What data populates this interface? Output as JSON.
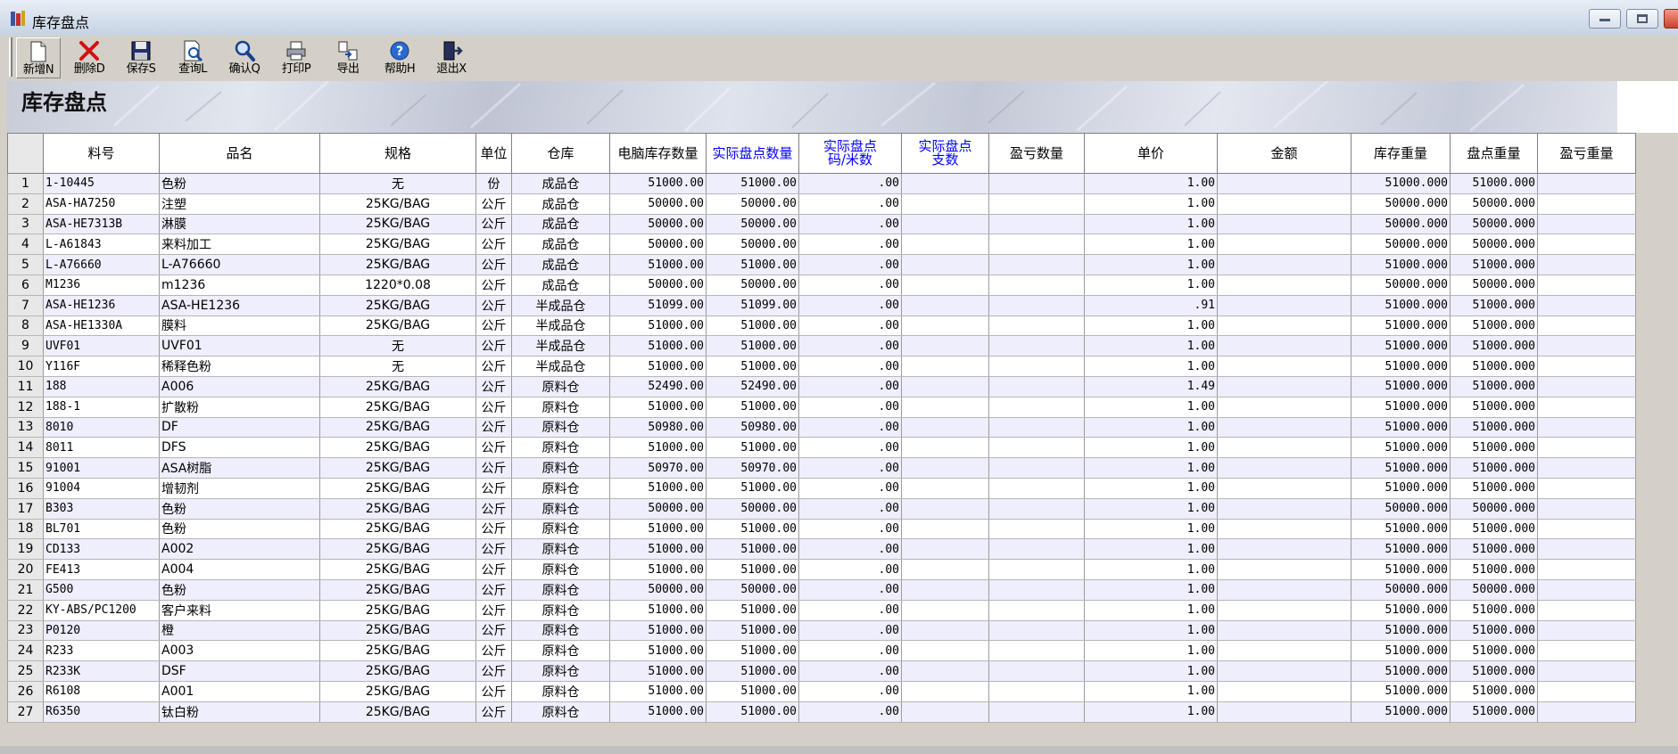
{
  "window": {
    "title": "库存盘点"
  },
  "toolbar": [
    {
      "label": "新增N",
      "icon": "new-document-icon",
      "name": "new"
    },
    {
      "label": "删除D",
      "icon": "delete-x-icon",
      "name": "delete"
    },
    {
      "label": "保存S",
      "icon": "save-disk-icon",
      "name": "save"
    },
    {
      "label": "查询L",
      "icon": "query-document-icon",
      "name": "query"
    },
    {
      "label": "确认Q",
      "icon": "magnifier-icon",
      "name": "confirm"
    },
    {
      "label": "打印P",
      "icon": "printer-icon",
      "name": "print"
    },
    {
      "label": "导出",
      "icon": "export-icon",
      "name": "export"
    },
    {
      "label": "帮助H",
      "icon": "help-icon",
      "name": "help"
    },
    {
      "label": "退出X",
      "icon": "exit-door-icon",
      "name": "exit"
    }
  ],
  "banner": {
    "title": "库存盘点"
  },
  "grid": {
    "columns": [
      {
        "key": "rownum",
        "label": "",
        "blue": false
      },
      {
        "key": "code",
        "label": "料号",
        "blue": false
      },
      {
        "key": "name",
        "label": "品名",
        "blue": false
      },
      {
        "key": "spec",
        "label": "规格",
        "blue": false
      },
      {
        "key": "unit",
        "label": "单位",
        "blue": false
      },
      {
        "key": "warehouse",
        "label": "仓库",
        "blue": false
      },
      {
        "key": "sys_qty",
        "label": "电脑库存数量",
        "blue": false
      },
      {
        "key": "act_qty",
        "label": "实际盘点数量",
        "blue": true
      },
      {
        "key": "act_code",
        "label": "实际盘点\n码/米数",
        "blue": true
      },
      {
        "key": "act_pcs",
        "label": "实际盘点\n支数",
        "blue": true
      },
      {
        "key": "diff_qty",
        "label": "盈亏数量",
        "blue": false
      },
      {
        "key": "price",
        "label": "单价",
        "blue": false
      },
      {
        "key": "amount",
        "label": "金额",
        "blue": false
      },
      {
        "key": "stock_wt",
        "label": "库存重量",
        "blue": false
      },
      {
        "key": "count_wt",
        "label": "盘点重量",
        "blue": false
      },
      {
        "key": "diff_wt",
        "label": "盈亏重量",
        "blue": false
      }
    ],
    "rows": [
      [
        "1",
        "1-10445",
        "色粉",
        "无",
        "份",
        "成品仓",
        "51000.00",
        "51000.00",
        ".00",
        "",
        "",
        "1.00",
        "",
        "51000.000",
        "51000.000",
        ""
      ],
      [
        "2",
        "ASA-HA7250",
        "注塑",
        "25KG/BAG",
        "公斤",
        "成品仓",
        "50000.00",
        "50000.00",
        ".00",
        "",
        "",
        "1.00",
        "",
        "50000.000",
        "50000.000",
        ""
      ],
      [
        "3",
        "ASA-HE7313B",
        "淋膜",
        "25KG/BAG",
        "公斤",
        "成品仓",
        "50000.00",
        "50000.00",
        ".00",
        "",
        "",
        "1.00",
        "",
        "50000.000",
        "50000.000",
        ""
      ],
      [
        "4",
        "L-A61843",
        "来料加工",
        "25KG/BAG",
        "公斤",
        "成品仓",
        "50000.00",
        "50000.00",
        ".00",
        "",
        "",
        "1.00",
        "",
        "50000.000",
        "50000.000",
        ""
      ],
      [
        "5",
        "L-A76660",
        "L-A76660",
        "25KG/BAG",
        "公斤",
        "成品仓",
        "51000.00",
        "51000.00",
        ".00",
        "",
        "",
        "1.00",
        "",
        "51000.000",
        "51000.000",
        ""
      ],
      [
        "6",
        "M1236",
        "m1236",
        "1220*0.08",
        "公斤",
        "成品仓",
        "50000.00",
        "50000.00",
        ".00",
        "",
        "",
        "1.00",
        "",
        "50000.000",
        "50000.000",
        ""
      ],
      [
        "7",
        "ASA-HE1236",
        "ASA-HE1236",
        "25KG/BAG",
        "公斤",
        "半成品仓",
        "51099.00",
        "51099.00",
        ".00",
        "",
        "",
        ".91",
        "",
        "51000.000",
        "51000.000",
        ""
      ],
      [
        "8",
        "ASA-HE1330A",
        "膜料",
        "25KG/BAG",
        "公斤",
        "半成品仓",
        "51000.00",
        "51000.00",
        ".00",
        "",
        "",
        "1.00",
        "",
        "51000.000",
        "51000.000",
        ""
      ],
      [
        "9",
        "UVF01",
        "UVF01",
        "无",
        "公斤",
        "半成品仓",
        "51000.00",
        "51000.00",
        ".00",
        "",
        "",
        "1.00",
        "",
        "51000.000",
        "51000.000",
        ""
      ],
      [
        "10",
        "Y116F",
        "稀释色粉",
        "无",
        "公斤",
        "半成品仓",
        "51000.00",
        "51000.00",
        ".00",
        "",
        "",
        "1.00",
        "",
        "51000.000",
        "51000.000",
        ""
      ],
      [
        "11",
        "188",
        "A006",
        "25KG/BAG",
        "公斤",
        "原料仓",
        "52490.00",
        "52490.00",
        ".00",
        "",
        "",
        "1.49",
        "",
        "51000.000",
        "51000.000",
        ""
      ],
      [
        "12",
        "188-1",
        "扩散粉",
        "25KG/BAG",
        "公斤",
        "原料仓",
        "51000.00",
        "51000.00",
        ".00",
        "",
        "",
        "1.00",
        "",
        "51000.000",
        "51000.000",
        ""
      ],
      [
        "13",
        "8010",
        "DF",
        "25KG/BAG",
        "公斤",
        "原料仓",
        "50980.00",
        "50980.00",
        ".00",
        "",
        "",
        "1.00",
        "",
        "51000.000",
        "51000.000",
        ""
      ],
      [
        "14",
        "8011",
        "DFS",
        "25KG/BAG",
        "公斤",
        "原料仓",
        "51000.00",
        "51000.00",
        ".00",
        "",
        "",
        "1.00",
        "",
        "51000.000",
        "51000.000",
        ""
      ],
      [
        "15",
        "91001",
        "ASA树脂",
        "25KG/BAG",
        "公斤",
        "原料仓",
        "50970.00",
        "50970.00",
        ".00",
        "",
        "",
        "1.00",
        "",
        "51000.000",
        "51000.000",
        ""
      ],
      [
        "16",
        "91004",
        "增韧剂",
        "25KG/BAG",
        "公斤",
        "原料仓",
        "51000.00",
        "51000.00",
        ".00",
        "",
        "",
        "1.00",
        "",
        "51000.000",
        "51000.000",
        ""
      ],
      [
        "17",
        "B303",
        "色粉",
        "25KG/BAG",
        "公斤",
        "原料仓",
        "50000.00",
        "50000.00",
        ".00",
        "",
        "",
        "1.00",
        "",
        "50000.000",
        "50000.000",
        ""
      ],
      [
        "18",
        "BL701",
        "色粉",
        "25KG/BAG",
        "公斤",
        "原料仓",
        "51000.00",
        "51000.00",
        ".00",
        "",
        "",
        "1.00",
        "",
        "51000.000",
        "51000.000",
        ""
      ],
      [
        "19",
        "CD133",
        "A002",
        "25KG/BAG",
        "公斤",
        "原料仓",
        "51000.00",
        "51000.00",
        ".00",
        "",
        "",
        "1.00",
        "",
        "51000.000",
        "51000.000",
        ""
      ],
      [
        "20",
        "FE413",
        "A004",
        "25KG/BAG",
        "公斤",
        "原料仓",
        "51000.00",
        "51000.00",
        ".00",
        "",
        "",
        "1.00",
        "",
        "51000.000",
        "51000.000",
        ""
      ],
      [
        "21",
        "G500",
        "色粉",
        "25KG/BAG",
        "公斤",
        "原料仓",
        "50000.00",
        "50000.00",
        ".00",
        "",
        "",
        "1.00",
        "",
        "50000.000",
        "50000.000",
        ""
      ],
      [
        "22",
        "KY-ABS/PC1200",
        "客户来料",
        "25KG/BAG",
        "公斤",
        "原料仓",
        "51000.00",
        "51000.00",
        ".00",
        "",
        "",
        "1.00",
        "",
        "51000.000",
        "51000.000",
        ""
      ],
      [
        "23",
        "P0120",
        "橙",
        "25KG/BAG",
        "公斤",
        "原料仓",
        "51000.00",
        "51000.00",
        ".00",
        "",
        "",
        "1.00",
        "",
        "51000.000",
        "51000.000",
        ""
      ],
      [
        "24",
        "R233",
        "A003",
        "25KG/BAG",
        "公斤",
        "原料仓",
        "51000.00",
        "51000.00",
        ".00",
        "",
        "",
        "1.00",
        "",
        "51000.000",
        "51000.000",
        ""
      ],
      [
        "25",
        "R233K",
        "DSF",
        "25KG/BAG",
        "公斤",
        "原料仓",
        "51000.00",
        "51000.00",
        ".00",
        "",
        "",
        "1.00",
        "",
        "51000.000",
        "51000.000",
        ""
      ],
      [
        "26",
        "R6108",
        "A001",
        "25KG/BAG",
        "公斤",
        "原料仓",
        "51000.00",
        "51000.00",
        ".00",
        "",
        "",
        "1.00",
        "",
        "51000.000",
        "51000.000",
        ""
      ],
      [
        "27",
        "R6350",
        "钛白粉",
        "25KG/BAG",
        "公斤",
        "原料仓",
        "51000.00",
        "51000.00",
        ".00",
        "",
        "",
        "1.00",
        "",
        "51000.000",
        "51000.000",
        ""
      ]
    ]
  }
}
